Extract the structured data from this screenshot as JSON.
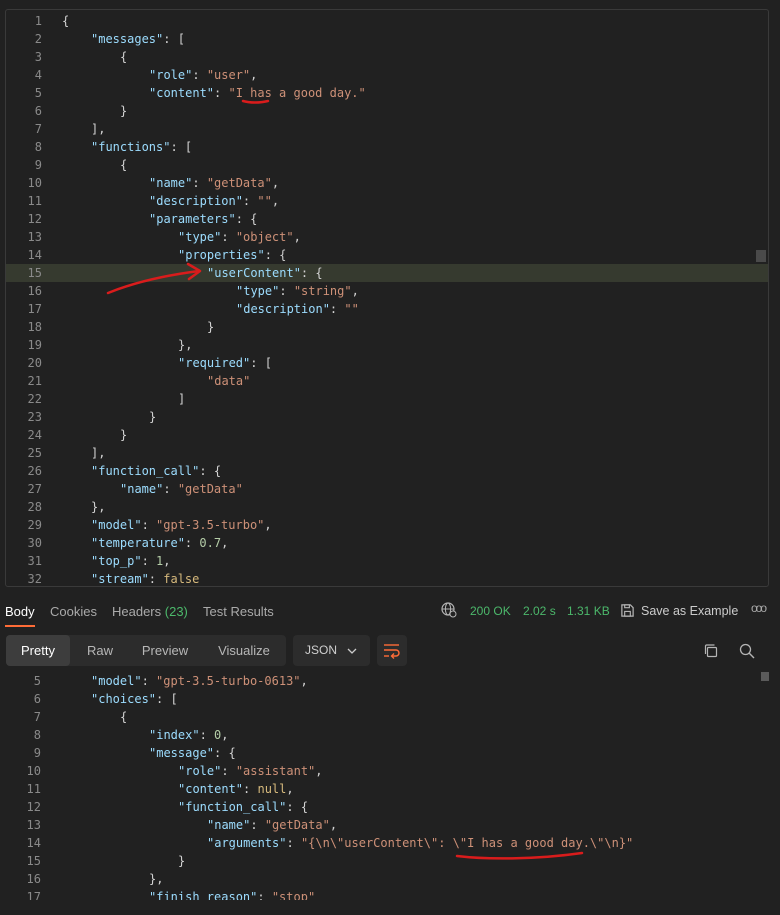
{
  "request_body": {
    "lines": [
      {
        "n": "1",
        "indent": 0,
        "tokens": [
          [
            "p",
            "{"
          ]
        ]
      },
      {
        "n": "2",
        "indent": 1,
        "tokens": [
          [
            "k",
            "\"messages\""
          ],
          [
            "p",
            ": ["
          ]
        ]
      },
      {
        "n": "3",
        "indent": 2,
        "tokens": [
          [
            "p",
            "{"
          ]
        ]
      },
      {
        "n": "4",
        "indent": 3,
        "tokens": [
          [
            "k",
            "\"role\""
          ],
          [
            "p",
            ": "
          ],
          [
            "s",
            "\"user\""
          ],
          [
            "p",
            ","
          ]
        ]
      },
      {
        "n": "5",
        "indent": 3,
        "tokens": [
          [
            "k",
            "\"content\""
          ],
          [
            "p",
            ": "
          ],
          [
            "s",
            "\"I has a good day.\""
          ]
        ]
      },
      {
        "n": "6",
        "indent": 2,
        "tokens": [
          [
            "p",
            "}"
          ]
        ]
      },
      {
        "n": "7",
        "indent": 1,
        "tokens": [
          [
            "p",
            "],"
          ]
        ]
      },
      {
        "n": "8",
        "indent": 1,
        "tokens": [
          [
            "k",
            "\"functions\""
          ],
          [
            "p",
            ": ["
          ]
        ]
      },
      {
        "n": "9",
        "indent": 2,
        "tokens": [
          [
            "p",
            "{"
          ]
        ]
      },
      {
        "n": "10",
        "indent": 3,
        "tokens": [
          [
            "k",
            "\"name\""
          ],
          [
            "p",
            ": "
          ],
          [
            "s",
            "\"getData\""
          ],
          [
            "p",
            ","
          ]
        ]
      },
      {
        "n": "11",
        "indent": 3,
        "tokens": [
          [
            "k",
            "\"description\""
          ],
          [
            "p",
            ": "
          ],
          [
            "s",
            "\"\""
          ],
          [
            "p",
            ","
          ]
        ]
      },
      {
        "n": "12",
        "indent": 3,
        "tokens": [
          [
            "k",
            "\"parameters\""
          ],
          [
            "p",
            ": {"
          ]
        ]
      },
      {
        "n": "13",
        "indent": 4,
        "tokens": [
          [
            "k",
            "\"type\""
          ],
          [
            "p",
            ": "
          ],
          [
            "s",
            "\"object\""
          ],
          [
            "p",
            ","
          ]
        ]
      },
      {
        "n": "14",
        "indent": 4,
        "tokens": [
          [
            "k",
            "\"properties\""
          ],
          [
            "p",
            ": "
          ],
          [
            "b",
            "{"
          ]
        ]
      },
      {
        "n": "15",
        "indent": 5,
        "tokens": [
          [
            "k",
            "\"userContent\""
          ],
          [
            "p",
            ": {"
          ]
        ],
        "highlight": true
      },
      {
        "n": "16",
        "indent": 6,
        "tokens": [
          [
            "k",
            "\"type\""
          ],
          [
            "p",
            ": "
          ],
          [
            "s",
            "\"string\""
          ],
          [
            "p",
            ","
          ]
        ]
      },
      {
        "n": "17",
        "indent": 6,
        "tokens": [
          [
            "k",
            "\"description\""
          ],
          [
            "p",
            ": "
          ],
          [
            "s",
            "\"\""
          ]
        ]
      },
      {
        "n": "18",
        "indent": 5,
        "tokens": [
          [
            "p",
            "}"
          ]
        ]
      },
      {
        "n": "19",
        "indent": 4,
        "tokens": [
          [
            "b",
            "}"
          ],
          [
            "p",
            ","
          ]
        ]
      },
      {
        "n": "20",
        "indent": 4,
        "tokens": [
          [
            "k",
            "\"required\""
          ],
          [
            "p",
            ": ["
          ]
        ]
      },
      {
        "n": "21",
        "indent": 5,
        "tokens": [
          [
            "s",
            "\"data\""
          ]
        ]
      },
      {
        "n": "22",
        "indent": 4,
        "tokens": [
          [
            "p",
            "]"
          ]
        ]
      },
      {
        "n": "23",
        "indent": 3,
        "tokens": [
          [
            "p",
            "}"
          ]
        ]
      },
      {
        "n": "24",
        "indent": 2,
        "tokens": [
          [
            "p",
            "}"
          ]
        ]
      },
      {
        "n": "25",
        "indent": 1,
        "tokens": [
          [
            "p",
            "],"
          ]
        ]
      },
      {
        "n": "26",
        "indent": 1,
        "tokens": [
          [
            "k",
            "\"function_call\""
          ],
          [
            "p",
            ": {"
          ]
        ]
      },
      {
        "n": "27",
        "indent": 2,
        "tokens": [
          [
            "k",
            "\"name\""
          ],
          [
            "p",
            ": "
          ],
          [
            "s",
            "\"getData\""
          ]
        ]
      },
      {
        "n": "28",
        "indent": 1,
        "tokens": [
          [
            "p",
            "},"
          ]
        ]
      },
      {
        "n": "29",
        "indent": 1,
        "tokens": [
          [
            "k",
            "\"model\""
          ],
          [
            "p",
            ": "
          ],
          [
            "s",
            "\"gpt-3.5-turbo\""
          ],
          [
            "p",
            ","
          ]
        ]
      },
      {
        "n": "30",
        "indent": 1,
        "tokens": [
          [
            "k",
            "\"temperature\""
          ],
          [
            "p",
            ": "
          ],
          [
            "n",
            "0.7"
          ],
          [
            "p",
            ","
          ]
        ]
      },
      {
        "n": "31",
        "indent": 1,
        "tokens": [
          [
            "k",
            "\"top_p\""
          ],
          [
            "p",
            ": "
          ],
          [
            "n",
            "1"
          ],
          [
            "p",
            ","
          ]
        ]
      },
      {
        "n": "32",
        "indent": 1,
        "tokens": [
          [
            "k",
            "\"stream\""
          ],
          [
            "p",
            ": "
          ],
          [
            "kw",
            "false"
          ]
        ]
      }
    ]
  },
  "response_tabs": {
    "body": "Body",
    "cookies": "Cookies",
    "headers": "Headers",
    "headers_count": "(23)",
    "test_results": "Test Results"
  },
  "status": {
    "code": "200 OK",
    "time": "2.02 s",
    "size": "1.31 KB",
    "save_label": "Save as Example",
    "more": "ooo"
  },
  "view_modes": {
    "pretty": "Pretty",
    "raw": "Raw",
    "preview": "Preview",
    "visualize": "Visualize",
    "format": "JSON"
  },
  "response_body": {
    "lines": [
      {
        "n": "5",
        "indent": 1,
        "tokens": [
          [
            "k",
            "\"model\""
          ],
          [
            "p",
            ": "
          ],
          [
            "s",
            "\"gpt-3.5-turbo-0613\""
          ],
          [
            "p",
            ","
          ]
        ]
      },
      {
        "n": "6",
        "indent": 1,
        "tokens": [
          [
            "k",
            "\"choices\""
          ],
          [
            "p",
            ": ["
          ]
        ]
      },
      {
        "n": "7",
        "indent": 2,
        "tokens": [
          [
            "p",
            "{"
          ]
        ]
      },
      {
        "n": "8",
        "indent": 3,
        "tokens": [
          [
            "k",
            "\"index\""
          ],
          [
            "p",
            ": "
          ],
          [
            "n",
            "0"
          ],
          [
            "p",
            ","
          ]
        ]
      },
      {
        "n": "9",
        "indent": 3,
        "tokens": [
          [
            "k",
            "\"message\""
          ],
          [
            "p",
            ": {"
          ]
        ]
      },
      {
        "n": "10",
        "indent": 4,
        "tokens": [
          [
            "k",
            "\"role\""
          ],
          [
            "p",
            ": "
          ],
          [
            "s",
            "\"assistant\""
          ],
          [
            "p",
            ","
          ]
        ]
      },
      {
        "n": "11",
        "indent": 4,
        "tokens": [
          [
            "k",
            "\"content\""
          ],
          [
            "p",
            ": "
          ],
          [
            "kw",
            "null"
          ],
          [
            "p",
            ","
          ]
        ]
      },
      {
        "n": "12",
        "indent": 4,
        "tokens": [
          [
            "k",
            "\"function_call\""
          ],
          [
            "p",
            ": {"
          ]
        ]
      },
      {
        "n": "13",
        "indent": 5,
        "tokens": [
          [
            "k",
            "\"name\""
          ],
          [
            "p",
            ": "
          ],
          [
            "s",
            "\"getData\""
          ],
          [
            "p",
            ","
          ]
        ]
      },
      {
        "n": "14",
        "indent": 5,
        "tokens": [
          [
            "k",
            "\"arguments\""
          ],
          [
            "p",
            ": "
          ],
          [
            "s",
            "\"{\\n\\\"userContent\\\": \\\"I has a good day.\\\"\\n}\""
          ]
        ]
      },
      {
        "n": "15",
        "indent": 4,
        "tokens": [
          [
            "p",
            "}"
          ]
        ]
      },
      {
        "n": "16",
        "indent": 3,
        "tokens": [
          [
            "p",
            "},"
          ]
        ]
      },
      {
        "n": "17",
        "indent": 3,
        "tokens": [
          [
            "k",
            "\"finish_reason\""
          ],
          [
            "p",
            ": "
          ],
          [
            "s",
            "\"stop\""
          ]
        ]
      }
    ]
  },
  "icons": {
    "globe": "globe-icon",
    "save": "save-icon",
    "more": "more-icon",
    "wrap": "wrap-lines-icon",
    "copy": "copy-icon",
    "search": "search-icon",
    "chevron": "chevron-down-icon"
  },
  "annotation_color": "#d91c1c",
  "accent_color": "#ff6c37"
}
